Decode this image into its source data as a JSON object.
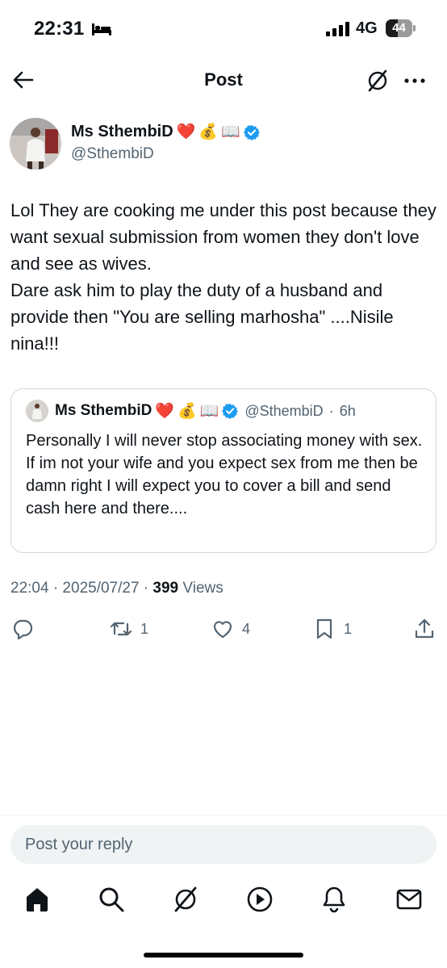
{
  "status_bar": {
    "time": "22:31",
    "network": "4G",
    "battery_level": "44",
    "battery_percent": 44
  },
  "header": {
    "title": "Post",
    "back_icon": "arrow-left-icon",
    "grok_icon": "grok-icon",
    "more_icon": "more-icon"
  },
  "post": {
    "author_name": "Ms SthembiD",
    "author_emojis": [
      "❤️",
      "💰",
      "📖"
    ],
    "author_handle": "@SthembiD",
    "verified": true,
    "text": "Lol They are cooking me under this post because they want sexual submission from women they don't love and see as wives.\nDare ask him to play the duty of a husband and provide then \"You are selling marhosha\" ....Nisile nina!!!",
    "timestamp": "22:04 · 2025/07/27 ·",
    "views_count": "399",
    "views_label": "Views"
  },
  "quote": {
    "author_name": "Ms SthembiD",
    "author_emojis": [
      "❤️",
      "💰",
      "📖"
    ],
    "author_handle": "@SthembiD",
    "dot": "·",
    "time": "6h",
    "text": "Personally I will never stop associating money with sex.\nIf im not your wife and you expect sex from me then be damn right I will expect you to cover a bill and send cash here and there...."
  },
  "actions": {
    "reply_count": "",
    "repost_count": "1",
    "like_count": "4",
    "bookmark_count": "1"
  },
  "reply_bar": {
    "placeholder": "Post your reply"
  },
  "tab_bar": {
    "items": [
      "home-icon",
      "search-icon",
      "grok-icon",
      "video-icon",
      "notifications-icon",
      "messages-icon"
    ]
  },
  "colors": {
    "text": "#0f1419",
    "secondary": "#536471",
    "verified": "#1d9bf0",
    "border": "#cfd9de",
    "input_bg": "#eff3f4"
  }
}
